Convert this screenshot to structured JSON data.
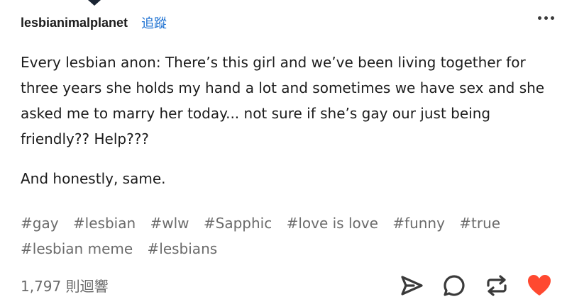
{
  "post": {
    "username": "lesbianimalplanet",
    "follow_label": "追蹤",
    "paragraphs": [
      "Every lesbian anon: There’s this girl and we’ve been living together for three years she holds my hand a lot and sometimes we have sex and she asked me to marry her today... not sure if she’s gay our just being friendly?? Help???",
      "And honestly, same."
    ],
    "tags": [
      "#gay",
      "#lesbian",
      "#wlw",
      "#Sapphic",
      "#love is love",
      "#funny",
      "#true",
      "#lesbian meme",
      "#lesbians"
    ],
    "notes_label": "1,797 則迴響"
  },
  "actions": {
    "share_icon": "share-icon",
    "reply_icon": "reply-icon",
    "reblog_icon": "reblog-icon",
    "like_icon": "heart-icon"
  },
  "colors": {
    "follow": "#1a6fd1",
    "tag": "#6b6b6b",
    "like": "#ff4930",
    "icon": "#3a3a3a"
  }
}
